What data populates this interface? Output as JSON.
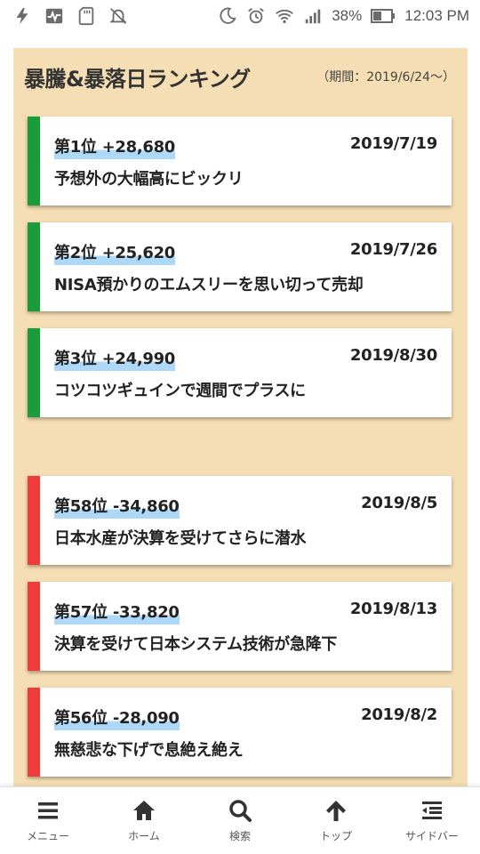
{
  "status_bar": {
    "left_icons": [
      "flash-icon",
      "pulse-icon",
      "sd-card-icon",
      "notifications-off-icon"
    ],
    "right_icons": [
      "do-not-disturb-moon-icon",
      "alarm-icon",
      "wifi-icon",
      "signal-icon"
    ],
    "battery": "38%",
    "time": "12:03 PM"
  },
  "panel": {
    "title": "暴騰&暴落日ランキング",
    "period": "（期間：2019/6/24〜）",
    "background": "#f5deb3"
  },
  "rankings_up": [
    {
      "rank": "第1位 +28,680",
      "date": "2019/7/19",
      "desc": "予想外の大幅高にビックリ"
    },
    {
      "rank": "第2位 +25,620",
      "date": "2019/7/26",
      "desc": "NISA預かりのエムスリーを思い切って売却"
    },
    {
      "rank": "第3位 +24,990",
      "date": "2019/8/30",
      "desc": "コツコツギュインで週間でプラスに"
    }
  ],
  "rankings_down": [
    {
      "rank": "第58位 -34,860",
      "date": "2019/8/5",
      "desc": "日本水産が決算を受けてさらに潜水"
    },
    {
      "rank": "第57位 -33,820",
      "date": "2019/8/13",
      "desc": "決算を受けて日本システム技術が急降下"
    },
    {
      "rank": "第56位 -28,090",
      "date": "2019/8/2",
      "desc": "無慈悲な下げで息絶え絶え"
    }
  ],
  "colors": {
    "up": "#1a9c3a",
    "down": "#f23c3c",
    "highlight": "#add8f7"
  },
  "bottom_nav": [
    {
      "label": "メニュー",
      "icon": "menu-icon"
    },
    {
      "label": "ホーム",
      "icon": "home-icon"
    },
    {
      "label": "検索",
      "icon": "search-icon"
    },
    {
      "label": "トップ",
      "icon": "arrow-up-icon"
    },
    {
      "label": "サイドバー",
      "icon": "sidebar-icon"
    }
  ]
}
